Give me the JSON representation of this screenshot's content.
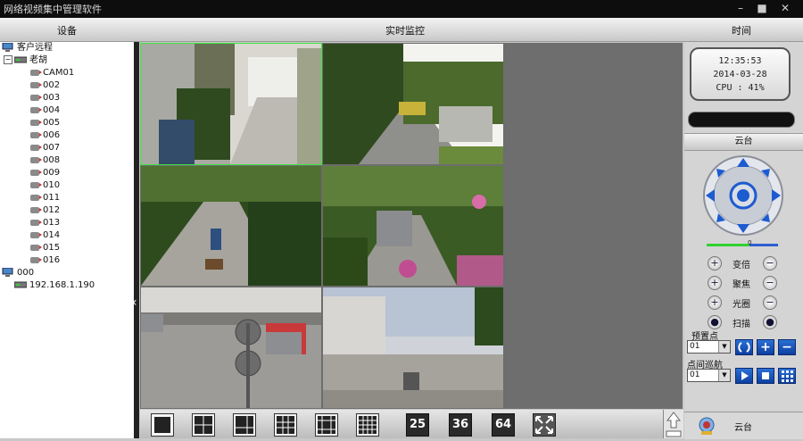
{
  "window": {
    "title": "网络视频集中管理软件"
  },
  "tabs": {
    "device": "设备",
    "live": "实时监控",
    "time": "时间"
  },
  "tree": {
    "root1": "客户远程",
    "group": "老胡",
    "cameras": [
      "CAM01",
      "002",
      "003",
      "004",
      "005",
      "006",
      "007",
      "008",
      "009",
      "010",
      "011",
      "012",
      "013",
      "014",
      "015",
      "016"
    ],
    "root2": "000",
    "ip": "192.168.1.190"
  },
  "clock": {
    "time": "12:35:53",
    "date": "2014-03-28",
    "cpu": "CPU : 41%"
  },
  "ptz": {
    "header": "云台",
    "slider_level": 0.6,
    "slider_value": "0",
    "zoom": "变倍",
    "focus": "聚焦",
    "iris": "光圈",
    "scan": "扫描",
    "preset_label": "预置点",
    "preset_value": "01",
    "cruise_label": "点间巡航",
    "cruise_value": "01"
  },
  "layouts": {
    "n25": "25",
    "n36": "36",
    "n64": "64"
  },
  "footer": {
    "label": "云台"
  },
  "colors": {
    "selected": "#3ee63e",
    "ptz_blue": "#1c5bd0"
  }
}
